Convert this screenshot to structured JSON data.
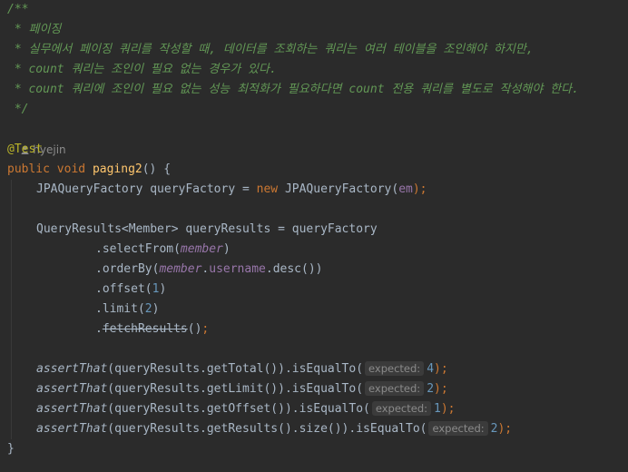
{
  "comment": {
    "open": "/**",
    "lines": [
      " * 페이징",
      " * 실무에서 페이징 쿼리를 작성할 때, 데이터를 조회하는 쿼리는 여러 테이블을 조인해야 하지만,",
      " * count 쿼리는 조인이 필요 없는 경우가 있다.",
      " * count 쿼리에 조인이 필요 없는 성능 최적화가 필요하다면 count 전용 쿼리를 별도로 작성해야 한다."
    ],
    "close": " */"
  },
  "author": "hyejin",
  "annotation": "@Test",
  "method": {
    "public": "public",
    "void": "void",
    "name": "paging2",
    "sig_end": "() {"
  },
  "body": {
    "factory_type": "JPAQueryFactory queryFactory = ",
    "new_kw": "new",
    "factory_ctor": " JPAQueryFactory(",
    "em": "em",
    "factory_end": ");",
    "results_decl": "QueryResults<Member> queryResults = queryFactory",
    "select_from": ".selectFrom(",
    "member": "member",
    "close_paren": ")",
    "order_by": ".orderBy(",
    "member2": "member",
    "dot": ".",
    "username": "username",
    "desc": ".desc())",
    "offset": ".offset(",
    "offset_val": "1",
    "limit": ".limit(",
    "limit_val": "2",
    "fetch_dot": ".",
    "fetch": "fetchResults",
    "fetch_end": "()",
    "semi": ";"
  },
  "asserts": [
    {
      "fn": "assertThat",
      "arg": "(queryResults.getTotal()).isEqualTo(",
      "hint": "expected:",
      "val": "4",
      "end": ");"
    },
    {
      "fn": "assertThat",
      "arg": "(queryResults.getLimit()).isEqualTo(",
      "hint": "expected:",
      "val": "2",
      "end": ");"
    },
    {
      "fn": "assertThat",
      "arg": "(queryResults.getOffset()).isEqualTo(",
      "hint": "expected:",
      "val": "1",
      "end": ");"
    },
    {
      "fn": "assertThat",
      "arg": "(queryResults.getResults().size()).isEqualTo(",
      "hint": "expected:",
      "val": "2",
      "end": ");"
    }
  ],
  "closing_brace": "}"
}
